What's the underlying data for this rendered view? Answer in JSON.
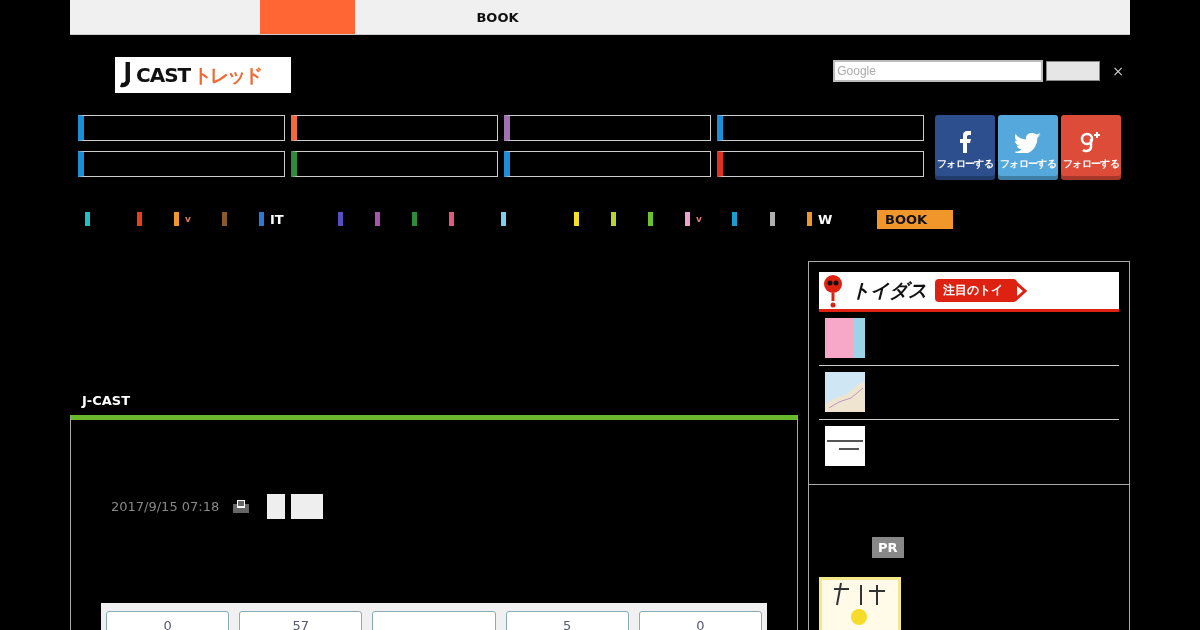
{
  "top_nav": [
    {
      "selected": true
    },
    {
      "label": "BOOK",
      "selected": false
    }
  ],
  "logo": {
    "latin": "CAST",
    "kana": "トレッド"
  },
  "search": {
    "placeholder": "Google",
    "close": "×"
  },
  "categories": [
    {
      "color": "#1a8fd8"
    },
    {
      "color": "#f26a3a"
    },
    {
      "color": "#a070b0"
    },
    {
      "color": "#1a8fd8"
    },
    {
      "color": "#1a8fd8"
    },
    {
      "color": "#2e8b3a"
    },
    {
      "color": "#1a8fd8"
    },
    {
      "color": "#e03020"
    }
  ],
  "social": [
    {
      "kind": "facebook",
      "label": "フォローする"
    },
    {
      "kind": "twitter",
      "label": "フォローする"
    },
    {
      "kind": "googleplus",
      "label": "フォローする"
    }
  ],
  "genre_nav": [
    {
      "color": "#1fc1c8"
    },
    {
      "color": "#e8401c"
    },
    {
      "color": "#f0962a",
      "caret": "v"
    },
    {
      "color": "#8b5a2b"
    },
    {
      "color": "#2a7ad6",
      "label": "IT"
    },
    {
      "color": "#5a4fc2"
    },
    {
      "color": "#a855b0"
    },
    {
      "color": "#2e8b3a"
    },
    {
      "color": "#e05a80"
    },
    {
      "color": "#7ccff0"
    },
    {
      "color": "#f5e12a"
    },
    {
      "color": "#b8d433"
    },
    {
      "color": "#6ac22c"
    },
    {
      "color": "#f0a0cc",
      "caret": "v"
    },
    {
      "color": "#1aa0d0"
    },
    {
      "color": "#b0b0b0"
    },
    {
      "color": "#f0962a",
      "label": "W"
    }
  ],
  "genre_button": "BOOK",
  "article": {
    "source": "J-CAST",
    "date": "2017/9/15 07:18",
    "counts": [
      {
        "kind": "number",
        "value": "0"
      },
      {
        "kind": "number",
        "value": "57"
      },
      {
        "kind": "blank"
      },
      {
        "kind": "number",
        "value": "5"
      },
      {
        "kind": "number",
        "value": "0"
      }
    ]
  },
  "sidebar": {
    "banner": {
      "title": "トイダス",
      "tag": "注目のトイ"
    },
    "pr": "PR"
  }
}
